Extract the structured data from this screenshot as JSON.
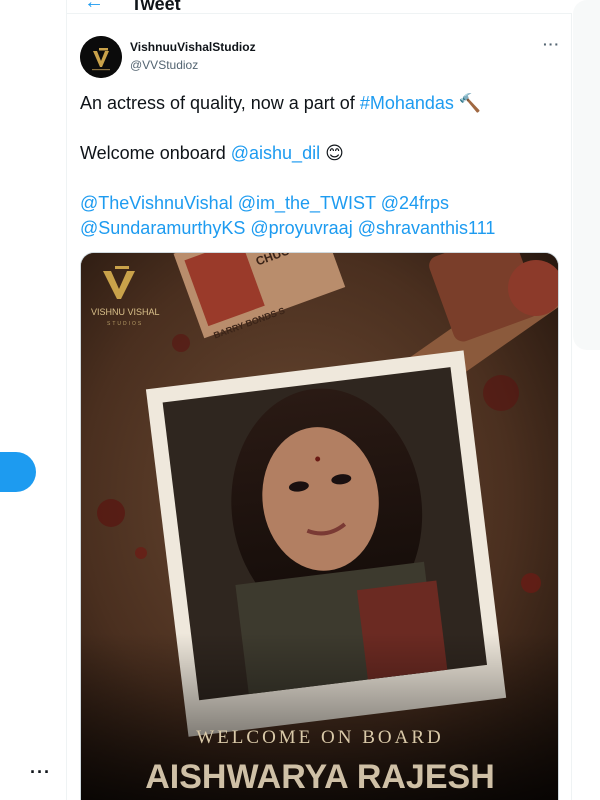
{
  "header": {
    "title": "Tweet",
    "back_icon": "arrow-left-icon"
  },
  "tweet": {
    "author_name": "VishnuuVishalStudioz",
    "author_handle": "@VVStudioz",
    "lines": {
      "l1_text": "An actress of quality, now a part of ",
      "l1_hashtag": "#Mohandas",
      "l1_emoji": "🔨",
      "l2_text": "Welcome onboard ",
      "l2_mention": "@aishu_dil",
      "l2_emoji": "😊",
      "l3_m1": "@TheVishnuVishal",
      "l3_m2": "@im_the_TWIST",
      "l3_m3": "@24frps",
      "l4_m1": "@SundaramurthyKS",
      "l4_m2": "@proyuvraaj",
      "l4_m3": "@shravanthis111"
    }
  },
  "poster": {
    "studio_name": "VISHNU VISHAL",
    "studio_sub": "STUDIOS",
    "book_text_1": "CHUC",
    "book_text_2": "BARRY BONDS S",
    "welcome": "WELCOME ON BOARD",
    "actor": "AISHWARYA RAJESH"
  },
  "colors": {
    "accent": "#1d9bf0",
    "text": "#0f1419",
    "muted": "#536471"
  }
}
